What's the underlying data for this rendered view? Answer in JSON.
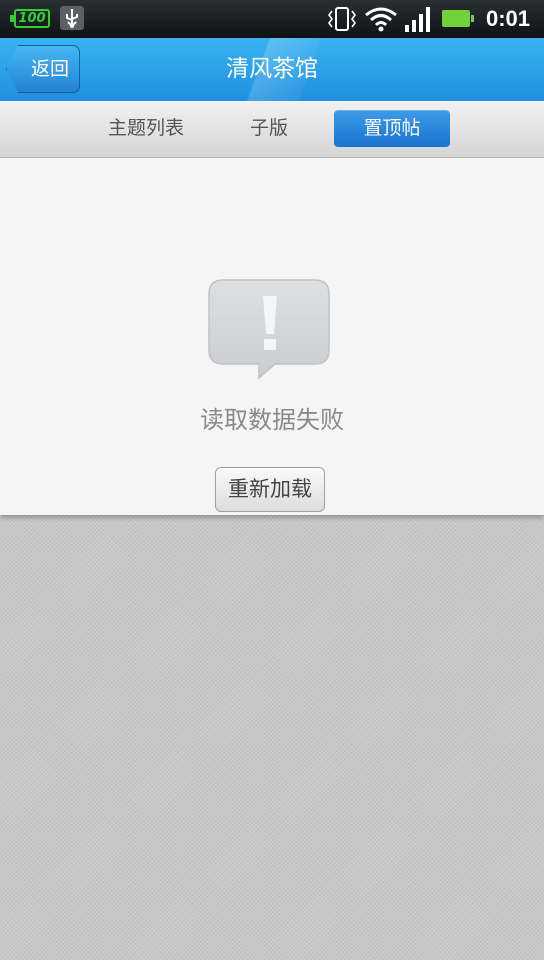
{
  "status_bar": {
    "battery_level": "100",
    "time": "0:01",
    "icons": [
      "battery-icon",
      "usb-icon",
      "vibrate-icon",
      "wifi-icon",
      "signal-icon",
      "battery-full-icon"
    ]
  },
  "header": {
    "back_label": "返回",
    "title": "清风茶馆"
  },
  "tabs": [
    {
      "label": "主题列表",
      "selected": false
    },
    {
      "label": "子版",
      "selected": false
    },
    {
      "label": "置顶帖",
      "selected": true
    }
  ],
  "content": {
    "error_message": "读取数据失败",
    "reload_label": "重新加载",
    "icon": "alert-bubble-icon"
  },
  "colors": {
    "title_bar": "#2a9fe8",
    "selected_tab": "#2a86dc",
    "battery_green": "#6fd23a"
  }
}
